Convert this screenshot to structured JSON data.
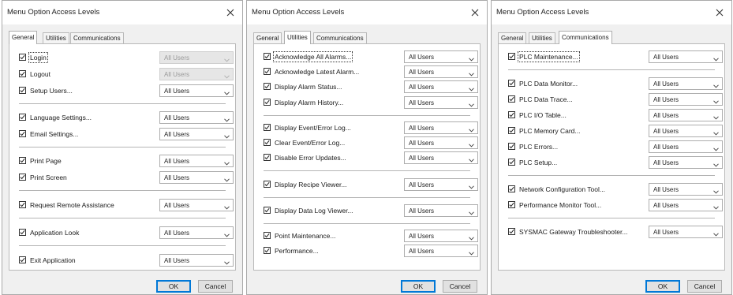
{
  "dialogs": [
    {
      "title": "Menu Option Access Levels",
      "tabs": [
        "General",
        "Utilities",
        "Communications"
      ],
      "active_tab": 0,
      "rows": [
        {
          "label": "Login",
          "value": "All Users",
          "checked": true,
          "disabled": true,
          "focused": true
        },
        {
          "label": "Logout",
          "value": "All Users",
          "checked": true,
          "disabled": true
        },
        {
          "label": "Setup Users...",
          "value": "All Users",
          "checked": true
        },
        {
          "separator": true
        },
        {
          "label": "Language Settings...",
          "value": "All Users",
          "checked": true
        },
        {
          "label": "Email Settings...",
          "value": "All Users",
          "checked": true
        },
        {
          "separator": true
        },
        {
          "label": "Print Page",
          "value": "All Users",
          "checked": true
        },
        {
          "label": "Print Screen",
          "value": "All Users",
          "checked": true
        },
        {
          "separator": true
        },
        {
          "label": "Request Remote Assistance",
          "value": "All Users",
          "checked": true
        },
        {
          "separator": true
        },
        {
          "label": "Application Look",
          "value": "All Users",
          "checked": true
        },
        {
          "separator": true
        },
        {
          "label": "Exit Application",
          "value": "All Users",
          "checked": true
        }
      ],
      "ok_label": "OK",
      "cancel_label": "Cancel"
    },
    {
      "title": "Menu Option Access Levels",
      "tabs": [
        "General",
        "Utilities",
        "Communications"
      ],
      "active_tab": 1,
      "rows": [
        {
          "label": "Acknowledge All Alarms...",
          "value": "All Users",
          "checked": true,
          "focused": true
        },
        {
          "label": "Acknowledge Latest Alarm...",
          "value": "All Users",
          "checked": true
        },
        {
          "label": "Display Alarm Status...",
          "value": "All Users",
          "checked": true
        },
        {
          "label": "Display Alarm History...",
          "value": "All Users",
          "checked": true
        },
        {
          "separator": true
        },
        {
          "label": "Display Event/Error Log...",
          "value": "All Users",
          "checked": true
        },
        {
          "label": "Clear Event/Error Log...",
          "value": "All Users",
          "checked": true
        },
        {
          "label": "Disable Error Updates...",
          "value": "All Users",
          "checked": true
        },
        {
          "separator": true
        },
        {
          "label": "Display Recipe Viewer...",
          "value": "All Users",
          "checked": true
        },
        {
          "separator": true
        },
        {
          "label": "Display Data Log Viewer...",
          "value": "All Users",
          "checked": true
        },
        {
          "separator": true
        },
        {
          "label": "Point Maintenance...",
          "value": "All Users",
          "checked": true
        },
        {
          "label": "Performance...",
          "value": "All Users",
          "checked": true
        }
      ],
      "ok_label": "OK",
      "cancel_label": "Cancel"
    },
    {
      "title": "Menu Option Access Levels",
      "tabs": [
        "General",
        "Utilities",
        "Communications"
      ],
      "active_tab": 2,
      "rows": [
        {
          "label": "PLC Maintenance...",
          "value": "All Users",
          "checked": true,
          "focused": true
        },
        {
          "separator": true
        },
        {
          "label": "PLC Data Monitor...",
          "value": "All Users",
          "checked": true
        },
        {
          "label": "PLC Data Trace...",
          "value": "All Users",
          "checked": true
        },
        {
          "label": "PLC I/O Table...",
          "value": "All Users",
          "checked": true
        },
        {
          "label": "PLC Memory Card...",
          "value": "All Users",
          "checked": true
        },
        {
          "label": "PLC Errors...",
          "value": "All Users",
          "checked": true
        },
        {
          "label": "PLC Setup...",
          "value": "All Users",
          "checked": true
        },
        {
          "separator": true
        },
        {
          "label": "Network Configuration Tool...",
          "value": "All Users",
          "checked": true
        },
        {
          "label": "Performance Monitor Tool...",
          "value": "All Users",
          "checked": true
        },
        {
          "separator": true
        },
        {
          "label": "SYSMAC Gateway Troubleshooter...",
          "value": "All Users",
          "checked": true
        }
      ],
      "ok_label": "OK",
      "cancel_label": "Cancel"
    }
  ]
}
